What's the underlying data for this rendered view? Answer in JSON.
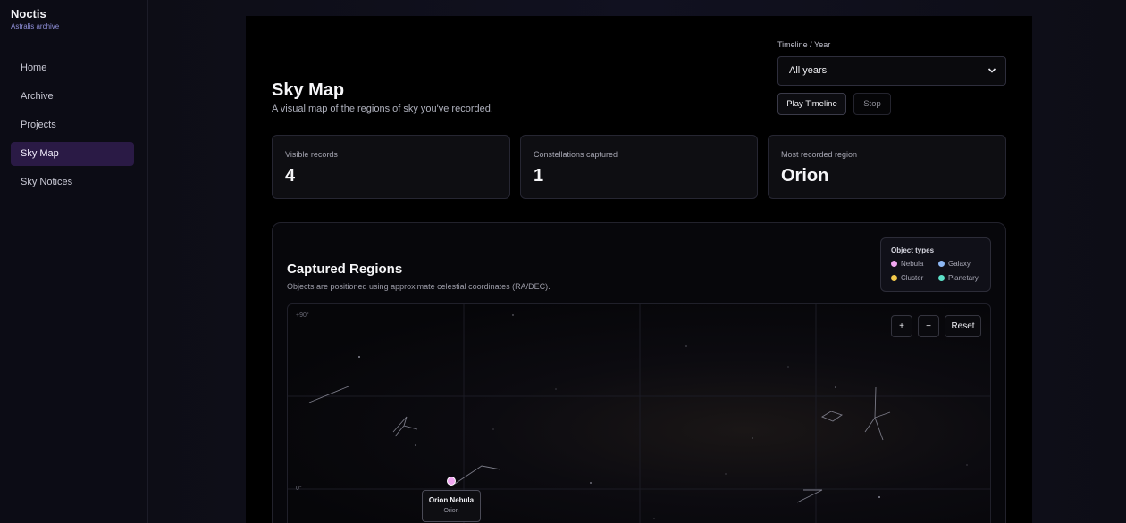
{
  "app": {
    "name": "Noctis",
    "subtitle": "Astralis archive"
  },
  "nav": [
    {
      "label": "Home",
      "active": false
    },
    {
      "label": "Archive",
      "active": false
    },
    {
      "label": "Projects",
      "active": false
    },
    {
      "label": "Sky Map",
      "active": true
    },
    {
      "label": "Sky Notices",
      "active": false
    }
  ],
  "page": {
    "title": "Sky Map",
    "subtitle": "A visual map of the regions of sky you've recorded."
  },
  "timeline": {
    "label": "Timeline / Year",
    "selected": "All years",
    "play_label": "Play Timeline",
    "stop_label": "Stop"
  },
  "stats": [
    {
      "label": "Visible records",
      "value": "4"
    },
    {
      "label": "Constellations captured",
      "value": "1"
    },
    {
      "label": "Most recorded region",
      "value": "Orion"
    }
  ],
  "regions": {
    "title": "Captured Regions",
    "subtitle": "Objects are positioned using approximate celestial coordinates (RA/DEC).",
    "legend": {
      "title": "Object types",
      "items": [
        {
          "label": "Nebula",
          "color": "#f0a6f0"
        },
        {
          "label": "Galaxy",
          "color": "#8eb8f4"
        },
        {
          "label": "Cluster",
          "color": "#f2c84a"
        },
        {
          "label": "Planetary",
          "color": "#5ce0c8"
        }
      ]
    },
    "map": {
      "axis_top": "+90°",
      "axis_mid": "0°",
      "zoom_in": "+",
      "zoom_out": "−",
      "reset": "Reset",
      "marker": {
        "name": "Orion Nebula",
        "region": "Orion",
        "type": "Nebula",
        "color": "#f0a6f0"
      }
    }
  }
}
